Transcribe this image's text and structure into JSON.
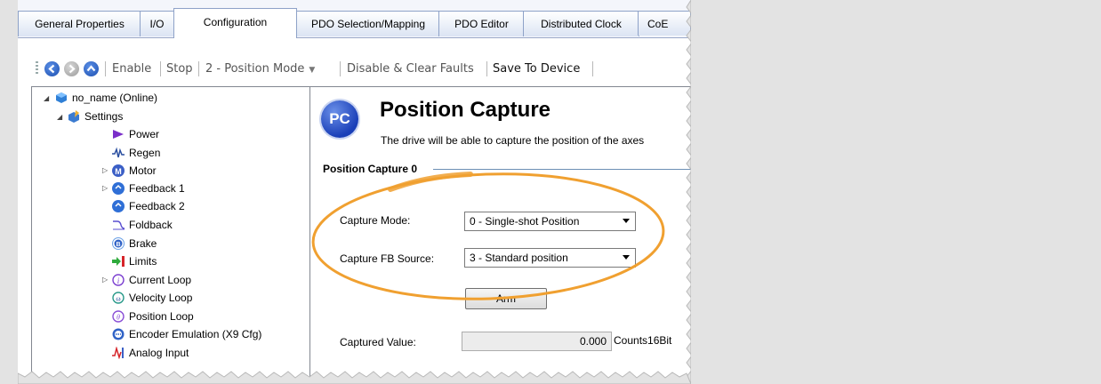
{
  "tabs": [
    {
      "label": "General Properties",
      "active": false
    },
    {
      "label": "I/O",
      "active": false
    },
    {
      "label": "Configuration",
      "active": true
    },
    {
      "label": "PDO Selection/Mapping",
      "active": false
    },
    {
      "label": "PDO Editor",
      "active": false
    },
    {
      "label": "Distributed Clock",
      "active": false
    },
    {
      "label": "CoE",
      "active": false
    }
  ],
  "toolbar": {
    "back_icon": "back-arrow-icon",
    "forward_icon": "forward-arrow-icon",
    "up_icon": "up-arrow-icon",
    "enable_label": "Enable",
    "stop_label": "Stop",
    "mode_label": "2 - Position Mode",
    "clear_faults_label": "Disable & Clear Faults",
    "save_label": "Save To Device"
  },
  "tree": {
    "root_label": "no_name (Online)",
    "settings_label": "Settings",
    "items": [
      {
        "label": "Power",
        "icon": "power-arrow-icon"
      },
      {
        "label": "Regen",
        "icon": "regen-wave-icon"
      },
      {
        "label": "Motor",
        "icon": "motor-icon"
      },
      {
        "label": "Feedback 1",
        "icon": "feedback-icon"
      },
      {
        "label": "Feedback 2",
        "icon": "feedback-icon"
      },
      {
        "label": "Foldback",
        "icon": "foldback-icon"
      },
      {
        "label": "Brake",
        "icon": "brake-icon"
      },
      {
        "label": "Limits",
        "icon": "limits-icon"
      },
      {
        "label": "Current Loop",
        "icon": "current-loop-icon"
      },
      {
        "label": "Velocity Loop",
        "icon": "velocity-loop-icon"
      },
      {
        "label": "Position Loop",
        "icon": "position-loop-icon"
      },
      {
        "label": "Encoder Emulation (X9 Cfg)",
        "icon": "encoder-emulation-icon"
      },
      {
        "label": "Analog Input",
        "icon": "analog-input-icon"
      }
    ]
  },
  "panel": {
    "badge": "PC",
    "title": "Position Capture",
    "description": "The drive will be able to capture the position of the axes",
    "group_title": "Position Capture 0",
    "capture_mode_label": "Capture Mode:",
    "capture_mode_value": "0 - Single-shot Position",
    "fb_source_label": "Capture FB Source:",
    "fb_source_value": "3 - Standard position",
    "arm_label": "Arm",
    "captured_value_label": "Captured Value:",
    "captured_value": "0.000",
    "captured_units": "Counts16Bit"
  },
  "colors": {
    "highlight_ellipse": "#f0a030",
    "badge_blue": "#1a3fb8",
    "tab_border": "#8ea2c8"
  }
}
